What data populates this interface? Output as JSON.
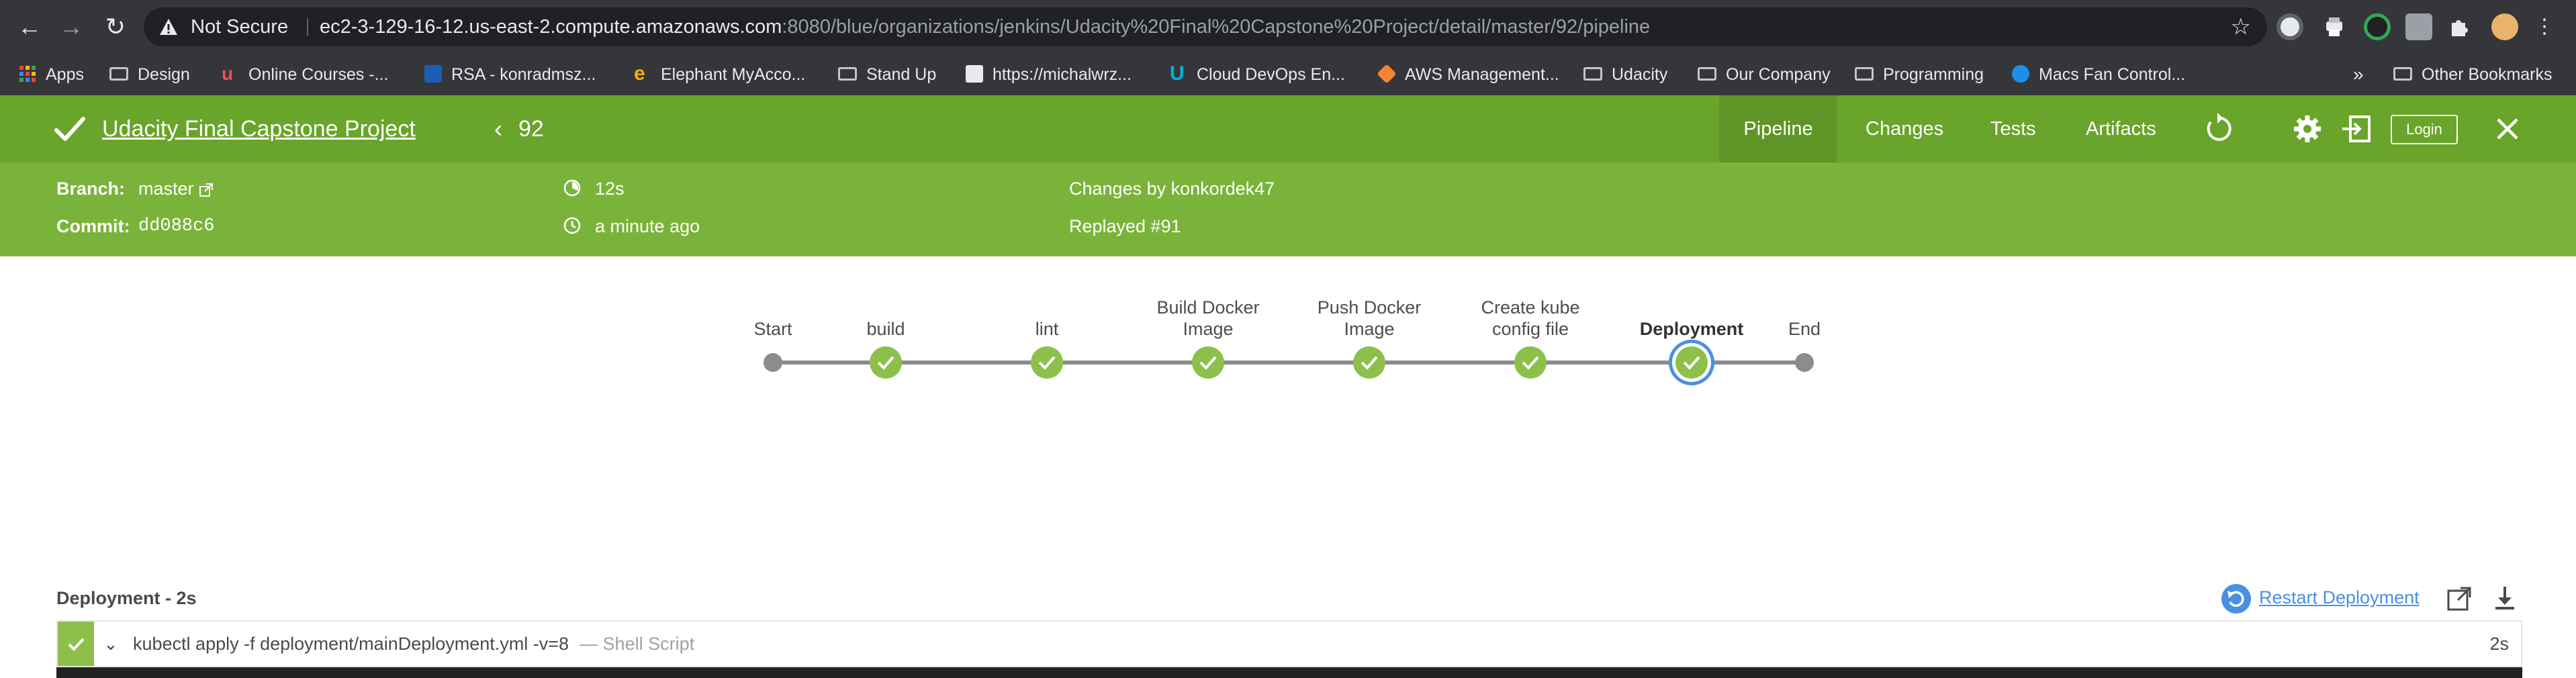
{
  "browser": {
    "security_label": "Not Secure",
    "url_host": "ec2-3-129-16-12.us-east-2.compute.amazonaws.com",
    "url_rest": ":8080/blue/organizations/jenkins/Udacity%20Final%20Capstone%20Project/detail/master/92/pipeline"
  },
  "bookmarks": [
    {
      "label": "Apps",
      "icon": "apps-grid-icon"
    },
    {
      "label": "Design",
      "icon": "folder-icon"
    },
    {
      "label": "Online Courses -...",
      "icon": "udemy-icon"
    },
    {
      "label": "RSA - konradmsz...",
      "icon": "rsa-icon"
    },
    {
      "label": "Elephant MyAcco...",
      "icon": "elephant-icon"
    },
    {
      "label": "Stand Up",
      "icon": "folder-icon"
    },
    {
      "label": "https://michalwrz...",
      "icon": "site-icon"
    },
    {
      "label": "Cloud DevOps En...",
      "icon": "udacity-icon"
    },
    {
      "label": "AWS Management...",
      "icon": "aws-icon"
    },
    {
      "label": "Udacity",
      "icon": "folder-icon"
    },
    {
      "label": "Our Company",
      "icon": "folder-icon"
    },
    {
      "label": "Programming",
      "icon": "folder-icon"
    },
    {
      "label": "Macs Fan Control...",
      "icon": "macs-fan-icon"
    },
    {
      "label": "»",
      "icon": "overflow-icon"
    },
    {
      "label": "Other Bookmarks",
      "icon": "folder-icon"
    }
  ],
  "run": {
    "project": "Udacity Final Capstone Project",
    "number": "92",
    "status_color": "#69a42b"
  },
  "tabs": {
    "pipeline": "Pipeline",
    "changes": "Changes",
    "tests": "Tests",
    "artifacts": "Artifacts",
    "login": "Login"
  },
  "details": {
    "branch_label": "Branch:",
    "branch_value": "master",
    "commit_label": "Commit:",
    "commit_value": "dd088c6",
    "duration": "12s",
    "ago": "a minute ago",
    "changes_by": "Changes by konkordek47",
    "replayed": "Replayed #91"
  },
  "stages": [
    {
      "label": "Start",
      "kind": "terminal"
    },
    {
      "label": "build",
      "kind": "success"
    },
    {
      "label": "lint",
      "kind": "success"
    },
    {
      "label": "Build Docker Image",
      "kind": "success"
    },
    {
      "label": "Push Docker Image",
      "kind": "success"
    },
    {
      "label": "Create kube config file",
      "kind": "success"
    },
    {
      "label": "Deployment",
      "kind": "success",
      "selected": true
    },
    {
      "label": "End",
      "kind": "terminal"
    }
  ],
  "stage_labels": {
    "s0": "Start",
    "s1": "build",
    "s2": "lint",
    "s3a": "Build Docker",
    "s3b": "Image",
    "s4a": "Push Docker",
    "s4b": "Image",
    "s5a": "Create kube",
    "s5b": "config file",
    "s6": "Deployment",
    "s7": "End"
  },
  "step_panel": {
    "title": "Deployment - 2s",
    "restart": "Restart Deployment",
    "command": "kubectl apply -f deployment/mainDeployment.yml -v=8",
    "type": "— Shell Script",
    "duration": "2s"
  }
}
